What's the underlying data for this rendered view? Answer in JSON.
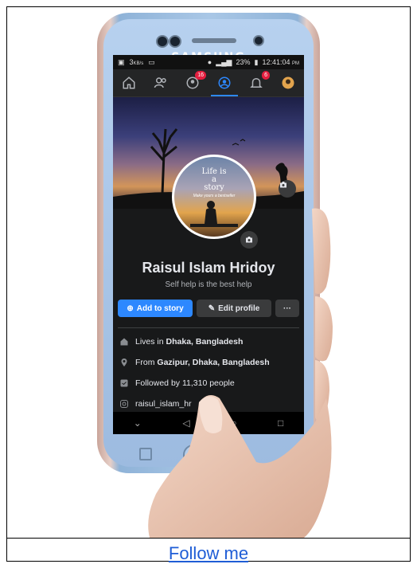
{
  "phone": {
    "brand": "SAMSUNG"
  },
  "statusbar": {
    "left_speed": "3",
    "left_speed_unit": "KB/s",
    "battery": "23%",
    "time": "12:41:04",
    "ampm": "PM"
  },
  "navbar": {
    "items": [
      {
        "icon": "home-icon"
      },
      {
        "icon": "friends-icon"
      },
      {
        "icon": "groups-icon",
        "badge": "16"
      },
      {
        "icon": "profile-icon",
        "active": true
      },
      {
        "icon": "notifications-icon",
        "badge": "6"
      },
      {
        "icon": "menu-avatar-icon"
      }
    ]
  },
  "avatar": {
    "line1": "Life is",
    "line2": "a",
    "line3": "story",
    "line4": "Make yours a bestseller"
  },
  "profile": {
    "name": "Raisul Islam Hridoy",
    "bio": "Self help is the best help"
  },
  "actions": {
    "add_story": "Add to story",
    "edit_profile": "Edit profile",
    "more": "···"
  },
  "details": {
    "lives_prefix": "Lives in ",
    "lives_place": "Dhaka, Bangladesh",
    "from_prefix": "From ",
    "from_place": "Gazipur, Dhaka, Bangladesh",
    "followers": "Followed by 11,310 people",
    "instagram": "raisul_islam_hr"
  },
  "caption": {
    "link": "Follow me"
  },
  "colors": {
    "accent": "#2d88ff",
    "link": "#1f5dd6",
    "screen_bg": "#18191a"
  }
}
